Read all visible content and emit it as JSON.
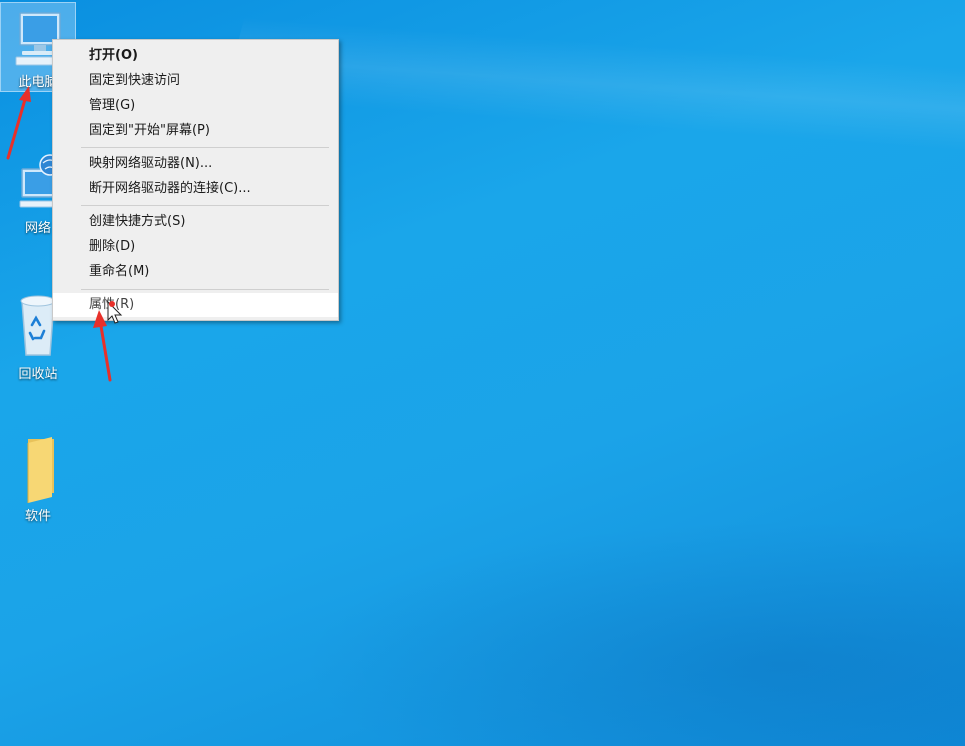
{
  "desktop": {
    "icons": [
      {
        "label": "此电脑",
        "icon": "computer-icon"
      },
      {
        "label": "网络",
        "icon": "network-icon"
      },
      {
        "label": "回收站",
        "icon": "recycle-bin-icon"
      },
      {
        "label": "软件",
        "icon": "folder-icon"
      }
    ]
  },
  "context_menu": {
    "items": [
      {
        "label": "打开(O)"
      },
      {
        "label": "固定到快速访问"
      },
      {
        "label": "管理(G)"
      },
      {
        "label": "固定到\"开始\"屏幕(P)"
      },
      {
        "label": "映射网络驱动器(N)..."
      },
      {
        "label": "断开网络驱动器的连接(C)..."
      },
      {
        "label": "创建快捷方式(S)"
      },
      {
        "label": "删除(D)"
      },
      {
        "label": "重命名(M)"
      },
      {
        "label": "属性(R)"
      }
    ]
  },
  "colors": {
    "desktop": "#1aa6ea",
    "menu_bg": "#efefef",
    "annotation_arrow": "#e8302a"
  }
}
